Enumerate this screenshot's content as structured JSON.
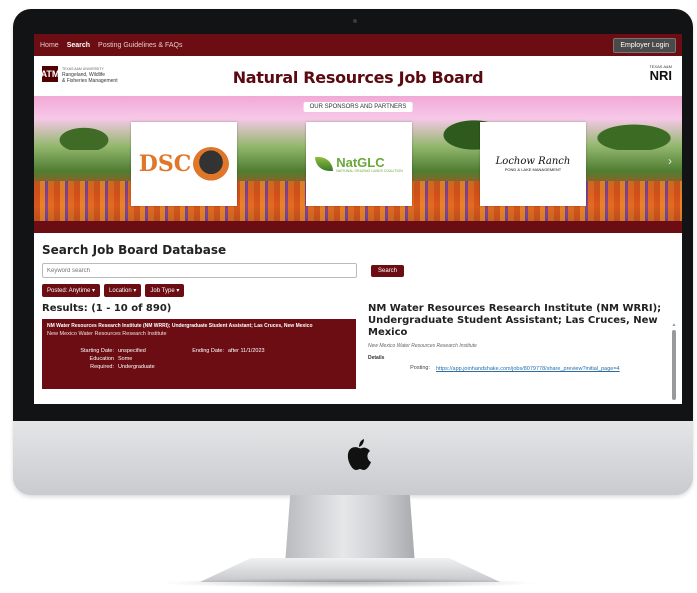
{
  "nav": {
    "items": [
      "Home",
      "Search",
      "Posting Guidelines & FAQs"
    ],
    "active_index": 1,
    "employer_login": "Employer Login"
  },
  "header": {
    "dept_line1": "TEXAS A&M UNIVERSITY",
    "dept_line2": "Rangeland, Wildlife",
    "dept_line3": "& Fisheries Management",
    "title": "Natural Resources Job Board",
    "nri_top": "TEXAS A&M",
    "nri": "NRI",
    "tamu_mark": "ATM"
  },
  "banner": {
    "sponsors_label": "OUR SPONSORS AND PARTNERS",
    "sponsor1": "DSC",
    "sponsor2": "NatGLC",
    "sponsor2_sub": "NATIONAL GRAZING LANDS COALITION",
    "sponsor3": "Lochow Ranch",
    "sponsor3_sub": "POND & LAKE MANAGEMENT",
    "next_icon": "›"
  },
  "search": {
    "heading": "Search Job Board Database",
    "placeholder": "Keyword search",
    "button": "Search",
    "filters": [
      "Posted: Anytime ▾",
      "Location ▾",
      "Job Type ▾"
    ]
  },
  "results": {
    "count": "Results: (1 - 10 of 890)",
    "first": {
      "title": "NM Water Resources Research Institute (NM WRRI); Undergraduate Student Assistant; Las Cruces, New Mexico",
      "org": "New Mexico Water Resources Research Institute",
      "starting_label": "Starting Date:",
      "starting_value": "unspecified",
      "ending_label": "Ending Date:",
      "ending_value": "after 11/1/2023",
      "education_label": "Education",
      "education_value": "Some",
      "required_label": "Required:",
      "required_value": "Undergraduate"
    }
  },
  "detail": {
    "title": "NM Water Resources Research Institute (NM WRRI); Undergraduate Student Assistant; Las Cruces, New Mexico",
    "org": "New Mexico Water Resources Research Institute",
    "details_label": "Details",
    "posting_label": "Posting:",
    "posting_url": "https://app.joinhandshake.com/jobs/8079778/share_preview?initial_page=4"
  },
  "colors": {
    "maroon": "#6b0d12",
    "link": "#2a6ea6"
  }
}
